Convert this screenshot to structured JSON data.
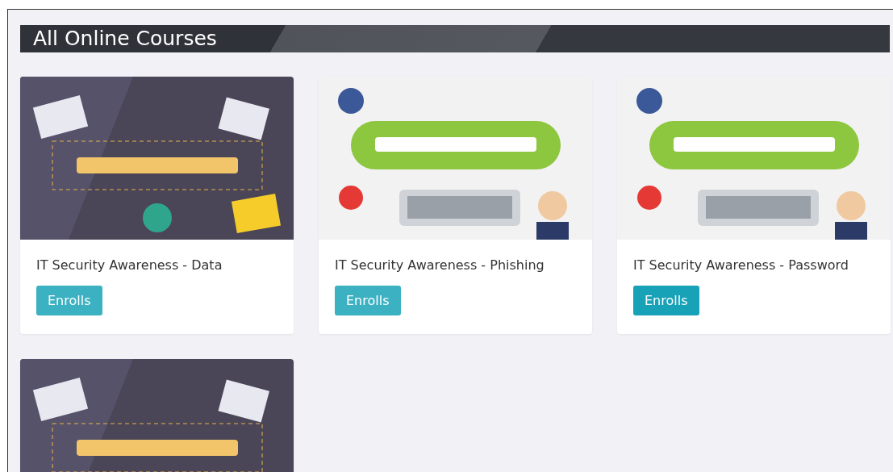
{
  "title": "All Online Courses",
  "courses": [
    {
      "kind": "picture",
      "name": "IT Security Awareness - Data",
      "button": "Enrolls",
      "hovered": false
    },
    {
      "kind": "picture",
      "name": "IT Security Awareness - Phishing",
      "button": "Enrolls",
      "hovered": false
    },
    {
      "kind": "picture",
      "name": "IT Security Awareness - Password",
      "button": "Enrolls",
      "hovered": true
    },
    {
      "kind": "picture"
    }
  ]
}
